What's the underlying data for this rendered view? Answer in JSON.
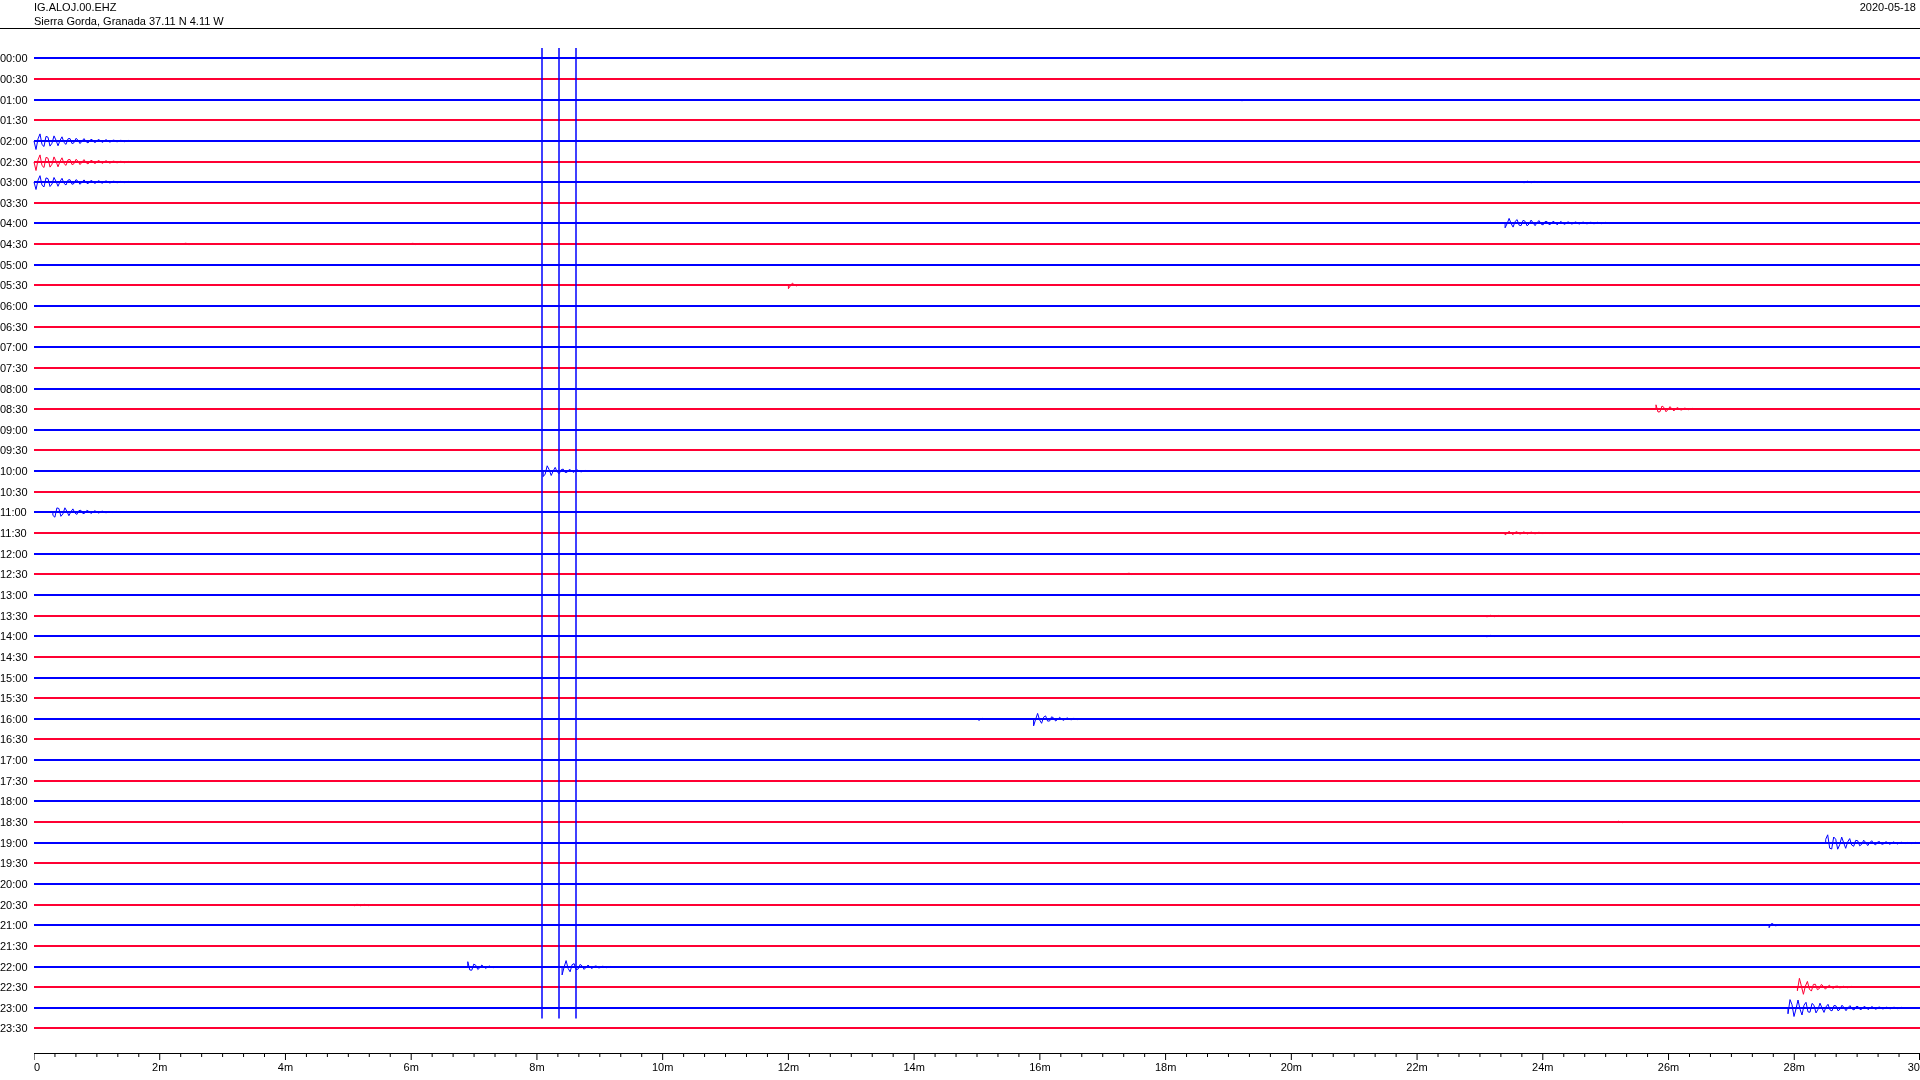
{
  "header": {
    "station": "IG.ALOJ.00.EHZ",
    "location": "Sierra Gorda, Granada  37.11 N 4.11 W",
    "date": "2020-05-18"
  },
  "rows": [
    {
      "label": "00:00",
      "color": "#0000ff"
    },
    {
      "label": "00:30",
      "color": "#ff0033"
    },
    {
      "label": "01:00",
      "color": "#0000ff"
    },
    {
      "label": "01:30",
      "color": "#ff0033"
    },
    {
      "label": "02:00",
      "color": "#0000ff"
    },
    {
      "label": "02:30",
      "color": "#ff0033"
    },
    {
      "label": "03:00",
      "color": "#0000ff"
    },
    {
      "label": "03:30",
      "color": "#ff0033"
    },
    {
      "label": "04:00",
      "color": "#0000ff"
    },
    {
      "label": "04:30",
      "color": "#ff0033"
    },
    {
      "label": "05:00",
      "color": "#0000ff"
    },
    {
      "label": "05:30",
      "color": "#ff0033"
    },
    {
      "label": "06:00",
      "color": "#0000ff"
    },
    {
      "label": "06:30",
      "color": "#ff0033"
    },
    {
      "label": "07:00",
      "color": "#0000ff"
    },
    {
      "label": "07:30",
      "color": "#ff0033"
    },
    {
      "label": "08:00",
      "color": "#0000ff"
    },
    {
      "label": "08:30",
      "color": "#ff0033"
    },
    {
      "label": "09:00",
      "color": "#0000ff"
    },
    {
      "label": "09:30",
      "color": "#ff0033"
    },
    {
      "label": "10:00",
      "color": "#0000ff"
    },
    {
      "label": "10:30",
      "color": "#ff0033"
    },
    {
      "label": "11:00",
      "color": "#0000ff"
    },
    {
      "label": "11:30",
      "color": "#ff0033"
    },
    {
      "label": "12:00",
      "color": "#0000ff"
    },
    {
      "label": "12:30",
      "color": "#ff0033"
    },
    {
      "label": "13:00",
      "color": "#0000ff"
    },
    {
      "label": "13:30",
      "color": "#ff0033"
    },
    {
      "label": "14:00",
      "color": "#0000ff"
    },
    {
      "label": "14:30",
      "color": "#ff0033"
    },
    {
      "label": "15:00",
      "color": "#0000ff"
    },
    {
      "label": "15:30",
      "color": "#ff0033"
    },
    {
      "label": "16:00",
      "color": "#0000ff"
    },
    {
      "label": "16:30",
      "color": "#ff0033"
    },
    {
      "label": "17:00",
      "color": "#0000ff"
    },
    {
      "label": "17:30",
      "color": "#ff0033"
    },
    {
      "label": "18:00",
      "color": "#0000ff"
    },
    {
      "label": "18:30",
      "color": "#ff0033"
    },
    {
      "label": "19:00",
      "color": "#0000ff"
    },
    {
      "label": "19:30",
      "color": "#ff0033"
    },
    {
      "label": "20:00",
      "color": "#0000ff"
    },
    {
      "label": "20:30",
      "color": "#ff0033"
    },
    {
      "label": "21:00",
      "color": "#0000ff"
    },
    {
      "label": "21:30",
      "color": "#ff0033"
    },
    {
      "label": "22:00",
      "color": "#0000ff"
    },
    {
      "label": "22:30",
      "color": "#ff0033"
    },
    {
      "label": "23:00",
      "color": "#0000ff"
    },
    {
      "label": "23:30",
      "color": "#ff0033"
    }
  ],
  "x_axis": {
    "ticks": [
      "0",
      "2m",
      "4m",
      "6m",
      "8m",
      "10m",
      "12m",
      "14m",
      "16m",
      "18m",
      "20m",
      "22m",
      "24m",
      "26m",
      "28m",
      "30"
    ]
  }
}
